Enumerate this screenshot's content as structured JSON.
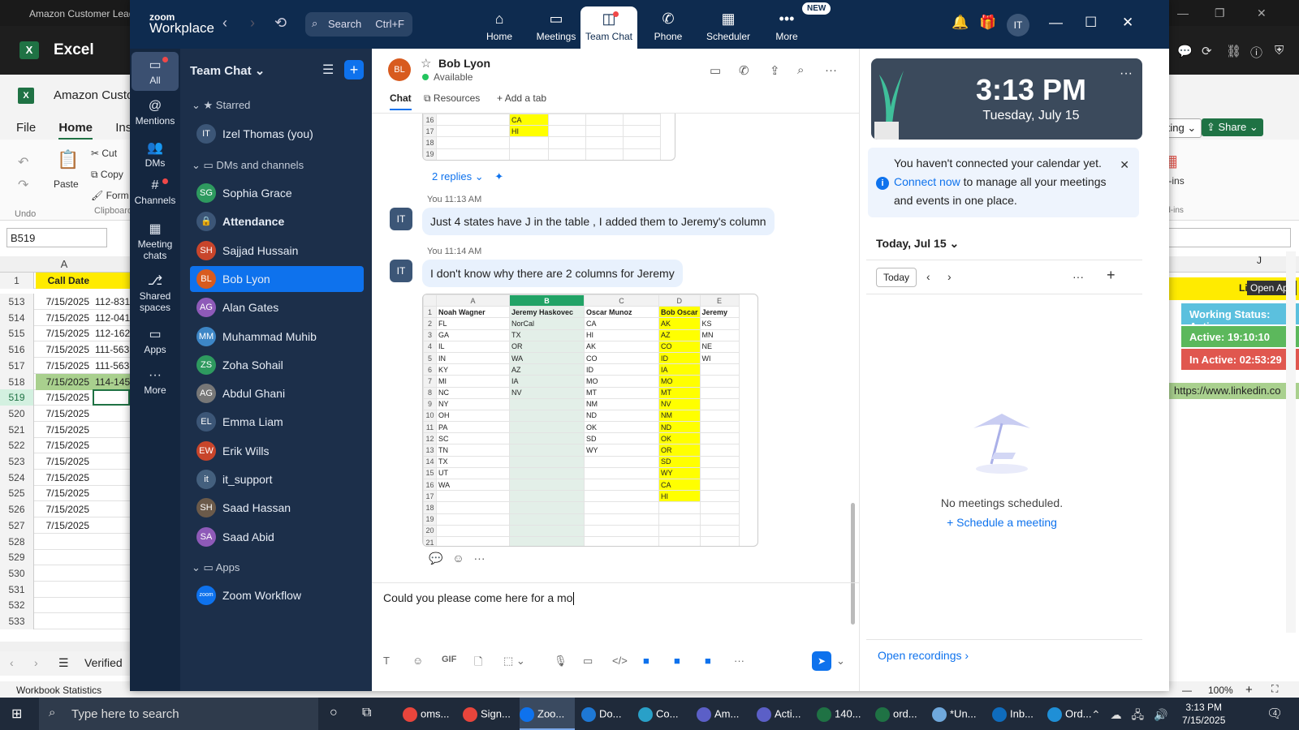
{
  "excel": {
    "window_title": "Amazon Customer Lead",
    "app_name": "Excel",
    "doc_name": "Amazon Custo",
    "tabs": [
      "File",
      "Home",
      "Insert"
    ],
    "ribbon": {
      "undo": "Undo",
      "paste": "Paste",
      "cut": "Cut",
      "copy": "Copy",
      "format": "Form",
      "clipboard": "Clipboard",
      "addins": "Add-ins",
      "addins_group": "Add-ins",
      "editing": "Editing",
      "share": "Share"
    },
    "name_box": "B519",
    "col_a": "A",
    "header_row": {
      "num": "1",
      "a": "Call Date",
      "b": ""
    },
    "rows": [
      {
        "num": "513",
        "a": "7/15/2025",
        "b": "112-831"
      },
      {
        "num": "514",
        "a": "7/15/2025",
        "b": "112-041"
      },
      {
        "num": "515",
        "a": "7/15/2025",
        "b": "112-162"
      },
      {
        "num": "516",
        "a": "7/15/2025",
        "b": "111-563"
      },
      {
        "num": "517",
        "a": "7/15/2025",
        "b": "111-563"
      },
      {
        "num": "518",
        "a": "7/15/2025",
        "b": "114-145"
      },
      {
        "num": "519",
        "a": "7/15/2025",
        "b": ""
      },
      {
        "num": "520",
        "a": "7/15/2025",
        "b": ""
      },
      {
        "num": "521",
        "a": "7/15/2025",
        "b": ""
      },
      {
        "num": "522",
        "a": "7/15/2025",
        "b": ""
      },
      {
        "num": "523",
        "a": "7/15/2025",
        "b": ""
      },
      {
        "num": "524",
        "a": "7/15/2025",
        "b": ""
      },
      {
        "num": "525",
        "a": "7/15/2025",
        "b": ""
      },
      {
        "num": "526",
        "a": "7/15/2025",
        "b": ""
      },
      {
        "num": "527",
        "a": "7/15/2025",
        "b": ""
      },
      {
        "num": "528",
        "a": "",
        "b": ""
      },
      {
        "num": "529",
        "a": "",
        "b": ""
      },
      {
        "num": "530",
        "a": "",
        "b": ""
      },
      {
        "num": "531",
        "a": "",
        "b": ""
      },
      {
        "num": "532",
        "a": "",
        "b": ""
      },
      {
        "num": "533",
        "a": "",
        "b": ""
      }
    ],
    "sheet_tab": "Verified",
    "status_left": "Workbook Statistics",
    "zoom": "100%",
    "right_col_header": "Lin",
    "open_app": "Open App",
    "working_status": "Working Status: Active",
    "active_time": "Active: 19:10:10",
    "inactive_time": "In Active: 02:53:29",
    "linkedin": "https://www.linkedin.co",
    "right_letter": "J",
    "colors": {
      "working": "#5bc0de",
      "active": "#5cb85c",
      "inactive": "#e0574f"
    }
  },
  "zoom": {
    "brand_top": "zoom",
    "brand_bottom": "Workplace",
    "search_label": "Search",
    "search_kbd": "Ctrl+F",
    "nav": [
      {
        "label": "Home",
        "icon": "⌂"
      },
      {
        "label": "Meetings",
        "icon": "▭"
      },
      {
        "label": "Team Chat",
        "icon": "◫"
      },
      {
        "label": "Phone",
        "icon": "✆"
      },
      {
        "label": "Scheduler",
        "icon": "▦"
      },
      {
        "label": "More",
        "icon": "•••"
      }
    ],
    "new_badge": "NEW",
    "user_initials": "IT",
    "rail": [
      {
        "label": "All",
        "icon": "▭"
      },
      {
        "label": "Mentions",
        "icon": "@"
      },
      {
        "label": "DMs",
        "icon": "👥"
      },
      {
        "label": "Channels",
        "icon": "#"
      },
      {
        "label": "Meeting chats",
        "icon": "▦"
      },
      {
        "label": "Shared spaces",
        "icon": "⎇"
      },
      {
        "label": "Apps",
        "icon": "▭"
      },
      {
        "label": "More",
        "icon": "···"
      }
    ],
    "sidebar": {
      "title": "Team Chat",
      "starred_label": "Starred",
      "dms_label": "DMs and channels",
      "apps_label": "Apps",
      "starred": [
        {
          "name": "Izel Thomas (you)",
          "initials": "IT",
          "color": "#3c5677"
        }
      ],
      "dms": [
        {
          "name": "Sophia Grace",
          "initials": "SG",
          "color": "#2e9a5f"
        },
        {
          "name": "Attendance",
          "initials": "🔒",
          "color": "#3c5677"
        },
        {
          "name": "Sajjad Hussain",
          "initials": "SH",
          "color": "#c8452b"
        },
        {
          "name": "Bob Lyon",
          "initials": "BL",
          "color": "#d85b1f"
        },
        {
          "name": "Alan Gates",
          "initials": "AG",
          "color": "#8e5ab8"
        },
        {
          "name": "Muhammad Muhib",
          "initials": "MM",
          "color": "#3d86c6"
        },
        {
          "name": "Zoha Sohail",
          "initials": "ZS",
          "color": "#2e9a5f"
        },
        {
          "name": "Abdul Ghani",
          "initials": "AG",
          "color": "#777777"
        },
        {
          "name": "Emma Liam",
          "initials": "EL",
          "color": "#3c5677"
        },
        {
          "name": "Erik Wills",
          "initials": "EW",
          "color": "#c8452b"
        },
        {
          "name": "it_support",
          "initials": "it",
          "color": "#44607e"
        },
        {
          "name": "Saad Hassan",
          "initials": "SH",
          "color": "#6b5a4a"
        },
        {
          "name": "Saad Abid",
          "initials": "SA",
          "color": "#8e5ab8"
        }
      ],
      "apps": [
        {
          "name": "Zoom Workflow",
          "initials": "zoom",
          "color": "#0e72ed"
        }
      ]
    },
    "chat": {
      "contact_name": "Bob Lyon",
      "contact_initials": "BL",
      "contact_status": "Available",
      "tabs": [
        "Chat",
        "Resources",
        "Add a tab"
      ],
      "replies": "2 replies",
      "top_sheet": [
        {
          "r": "16",
          "c": "CA"
        },
        {
          "r": "17",
          "c": "HI"
        },
        {
          "r": "18",
          "c": ""
        },
        {
          "r": "19",
          "c": ""
        }
      ],
      "messages": [
        {
          "sender": "IT",
          "time": "You 11:13 AM",
          "text": "Just 4 states have J in the table , I added them to Jeremy's column"
        },
        {
          "sender": "IT",
          "time": "You 11:14 AM",
          "text": "I don't know why there are 2 columns for Jeremy"
        }
      ],
      "sheet": {
        "cols": [
          "A",
          "B",
          "C",
          "D",
          "E"
        ],
        "header": [
          "Noah Wagner",
          "Jeremy Haskovec",
          "Oscar Munoz",
          "Bob Oscar",
          "Jeremy"
        ],
        "rows": [
          [
            "FL",
            "NorCal",
            "CA",
            "AK",
            "KS"
          ],
          [
            "GA",
            "TX",
            "HI",
            "AZ",
            "MN"
          ],
          [
            "IL",
            "OR",
            "AK",
            "CO",
            "NE"
          ],
          [
            "IN",
            "WA",
            "CO",
            "ID",
            "WI"
          ],
          [
            "KY",
            "AZ",
            "ID",
            "IA",
            ""
          ],
          [
            "MI",
            "IA",
            "MO",
            "MO",
            ""
          ],
          [
            "NC",
            "NV",
            "MT",
            "MT",
            ""
          ],
          [
            "NY",
            "",
            "NM",
            "NV",
            ""
          ],
          [
            "OH",
            "",
            "ND",
            "NM",
            ""
          ],
          [
            "PA",
            "",
            "OK",
            "ND",
            ""
          ],
          [
            "SC",
            "",
            "SD",
            "OK",
            ""
          ],
          [
            "TN",
            "",
            "WY",
            "OR",
            ""
          ],
          [
            "TX",
            "",
            "",
            "SD",
            ""
          ],
          [
            "UT",
            "",
            "",
            "WY",
            ""
          ],
          [
            "WA",
            "",
            "",
            "CA",
            ""
          ],
          [
            "",
            "",
            "",
            "HI",
            ""
          ],
          [
            "",
            "",
            "",
            "",
            ""
          ],
          [
            "",
            "",
            "",
            "",
            ""
          ],
          [
            "",
            "",
            "",
            "",
            ""
          ],
          [
            "",
            "",
            "",
            "",
            ""
          ]
        ]
      },
      "compose_text": "Could you please come here for a mo"
    },
    "calendar": {
      "time": "3:13 PM",
      "date": "Tuesday, July 15",
      "notice_pre": "You haven't connected your calendar yet. ",
      "notice_link": "Connect now",
      "notice_post": " to manage all your meetings and events in one place.",
      "today_header": "Today, Jul 15",
      "today_button": "Today",
      "no_meetings": "No meetings scheduled.",
      "schedule": "Schedule a meeting",
      "open_recordings": "Open recordings"
    }
  },
  "taskbar": {
    "search_placeholder": "Type here to search",
    "apps": [
      {
        "label": "oms...",
        "color": "#e8453c"
      },
      {
        "label": "Sign...",
        "color": "#e8453c"
      },
      {
        "label": "Zoo...",
        "color": "#0e72ed"
      },
      {
        "label": "Do...",
        "color": "#1e78d4"
      },
      {
        "label": "Co...",
        "color": "#29a0c8"
      },
      {
        "label": "Am...",
        "color": "#5b5fc7"
      },
      {
        "label": "Acti...",
        "color": "#5b5fc7"
      },
      {
        "label": "140...",
        "color": "#1f7244"
      },
      {
        "label": "ord...",
        "color": "#1f7244"
      },
      {
        "label": "*Un...",
        "color": "#6fa8dc"
      },
      {
        "label": "Inb...",
        "color": "#0f6cbd"
      },
      {
        "label": "Ord...",
        "color": "#1f8fd6"
      }
    ],
    "clock_time": "3:13 PM",
    "clock_date": "7/15/2025",
    "notif_count": "4"
  }
}
